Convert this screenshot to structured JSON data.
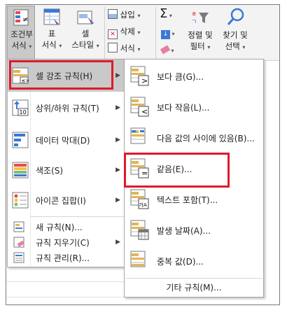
{
  "ribbon": {
    "cond_format": [
      "조건부",
      "서식"
    ],
    "table": [
      "표",
      "서식"
    ],
    "cell_style": [
      "셀",
      "스타일"
    ],
    "insert": "삽입",
    "delete": "삭제",
    "format": "서식",
    "sigma": "Σ",
    "sort_filter": [
      "정렬 및",
      "필터"
    ],
    "find_select": [
      "찾기 및",
      "선택"
    ]
  },
  "main_menu": [
    {
      "label": "셀 강조 규칙(H)",
      "mnemonic": "H",
      "icon": "highlight-rules-icon",
      "submenu": true
    },
    {
      "label": "상위/하위 규칙(T)",
      "mnemonic": "T",
      "icon": "top-bottom-rules-icon",
      "submenu": true
    },
    {
      "label": "데이터 막대(D)",
      "mnemonic": "D",
      "icon": "data-bars-icon",
      "submenu": true
    },
    {
      "label": "색조(S)",
      "mnemonic": "S",
      "icon": "color-scales-icon",
      "submenu": true
    },
    {
      "label": "아이콘 집합(I)",
      "mnemonic": "I",
      "icon": "icon-sets-icon",
      "submenu": true
    }
  ],
  "main_menu_small": [
    {
      "label": "새 규칙(N)...",
      "icon": "new-rule-icon"
    },
    {
      "label": "규칙 지우기(C)",
      "icon": "clear-rules-icon",
      "submenu": true
    },
    {
      "label": "규칙 관리(R)...",
      "icon": "manage-rules-icon"
    }
  ],
  "submenu": [
    {
      "label": "보다 큼(G)...",
      "icon": "greater-than-icon",
      "glyph": ">"
    },
    {
      "label": "보다 작음(L)...",
      "icon": "less-than-icon",
      "glyph": "<"
    },
    {
      "label": "다음 값의 사이에 있음(B)...",
      "icon": "between-icon",
      "glyph": ""
    },
    {
      "label": "같음(E)...",
      "icon": "equal-to-icon",
      "glyph": "="
    },
    {
      "label": "텍스트 포함(T)...",
      "icon": "text-contains-icon",
      "glyph": "가A"
    },
    {
      "label": "발생 날짜(A)...",
      "icon": "date-occurring-icon",
      "glyph": ""
    },
    {
      "label": "중복 값(D)...",
      "icon": "duplicate-values-icon",
      "glyph": ""
    }
  ],
  "submenu_more": "기타 규칙(M)...",
  "colors": {
    "highlight": "#c9c9c9",
    "callout": "#e0192b"
  }
}
